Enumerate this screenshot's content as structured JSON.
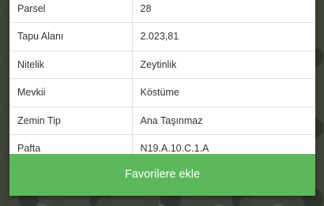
{
  "parcel_info": {
    "rows": [
      {
        "label": "Parsel",
        "value": "28"
      },
      {
        "label": "Tapu Alanı",
        "value": "2.023,81"
      },
      {
        "label": "Nitelik",
        "value": "Zeytinlik"
      },
      {
        "label": "Mevkii",
        "value": "Köstüme"
      },
      {
        "label": "Zemin Tip",
        "value": "Ana Taşınmaz"
      },
      {
        "label": "Pafta",
        "value": "N19.A.10.C.1.A"
      }
    ]
  },
  "actions": {
    "favorite_label": "Favorilere ekle",
    "favorite_color": "#5cb85c"
  }
}
